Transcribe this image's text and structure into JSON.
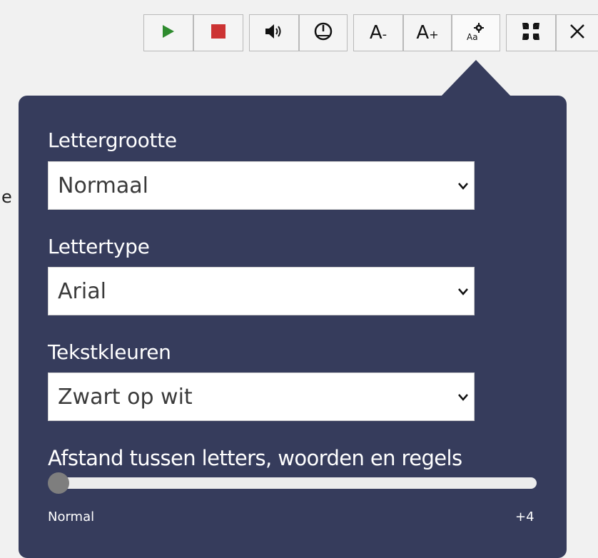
{
  "background_text": "e",
  "toolbar": {
    "buttons": [
      {
        "id": "play",
        "icon": "play-icon"
      },
      {
        "id": "stop",
        "icon": "stop-icon"
      },
      {
        "id": "volume",
        "icon": "speaker-icon"
      },
      {
        "id": "speed",
        "icon": "gauge-icon"
      },
      {
        "id": "font_smaller",
        "label": "A-"
      },
      {
        "id": "font_larger",
        "label": "A+"
      },
      {
        "id": "text_settings",
        "label": "Aa",
        "icon": "gear-icon"
      },
      {
        "id": "collapse",
        "icon": "collapse-icon"
      },
      {
        "id": "close",
        "icon": "close-icon"
      }
    ],
    "colors": {
      "play": "#2e8b2e",
      "stop": "#cc3333"
    }
  },
  "settings": {
    "font_size": {
      "label": "Lettergrootte",
      "value": "Normaal"
    },
    "font_family": {
      "label": "Lettertype",
      "value": "Arial"
    },
    "text_color": {
      "label": "Tekstkleuren",
      "value": "Zwart op wit"
    },
    "spacing": {
      "label": "Afstand tussen letters, woorden en regels",
      "min_label": "Normal",
      "max_label": "+4",
      "value": 0
    }
  },
  "colors": {
    "panel": "#363c5c"
  }
}
